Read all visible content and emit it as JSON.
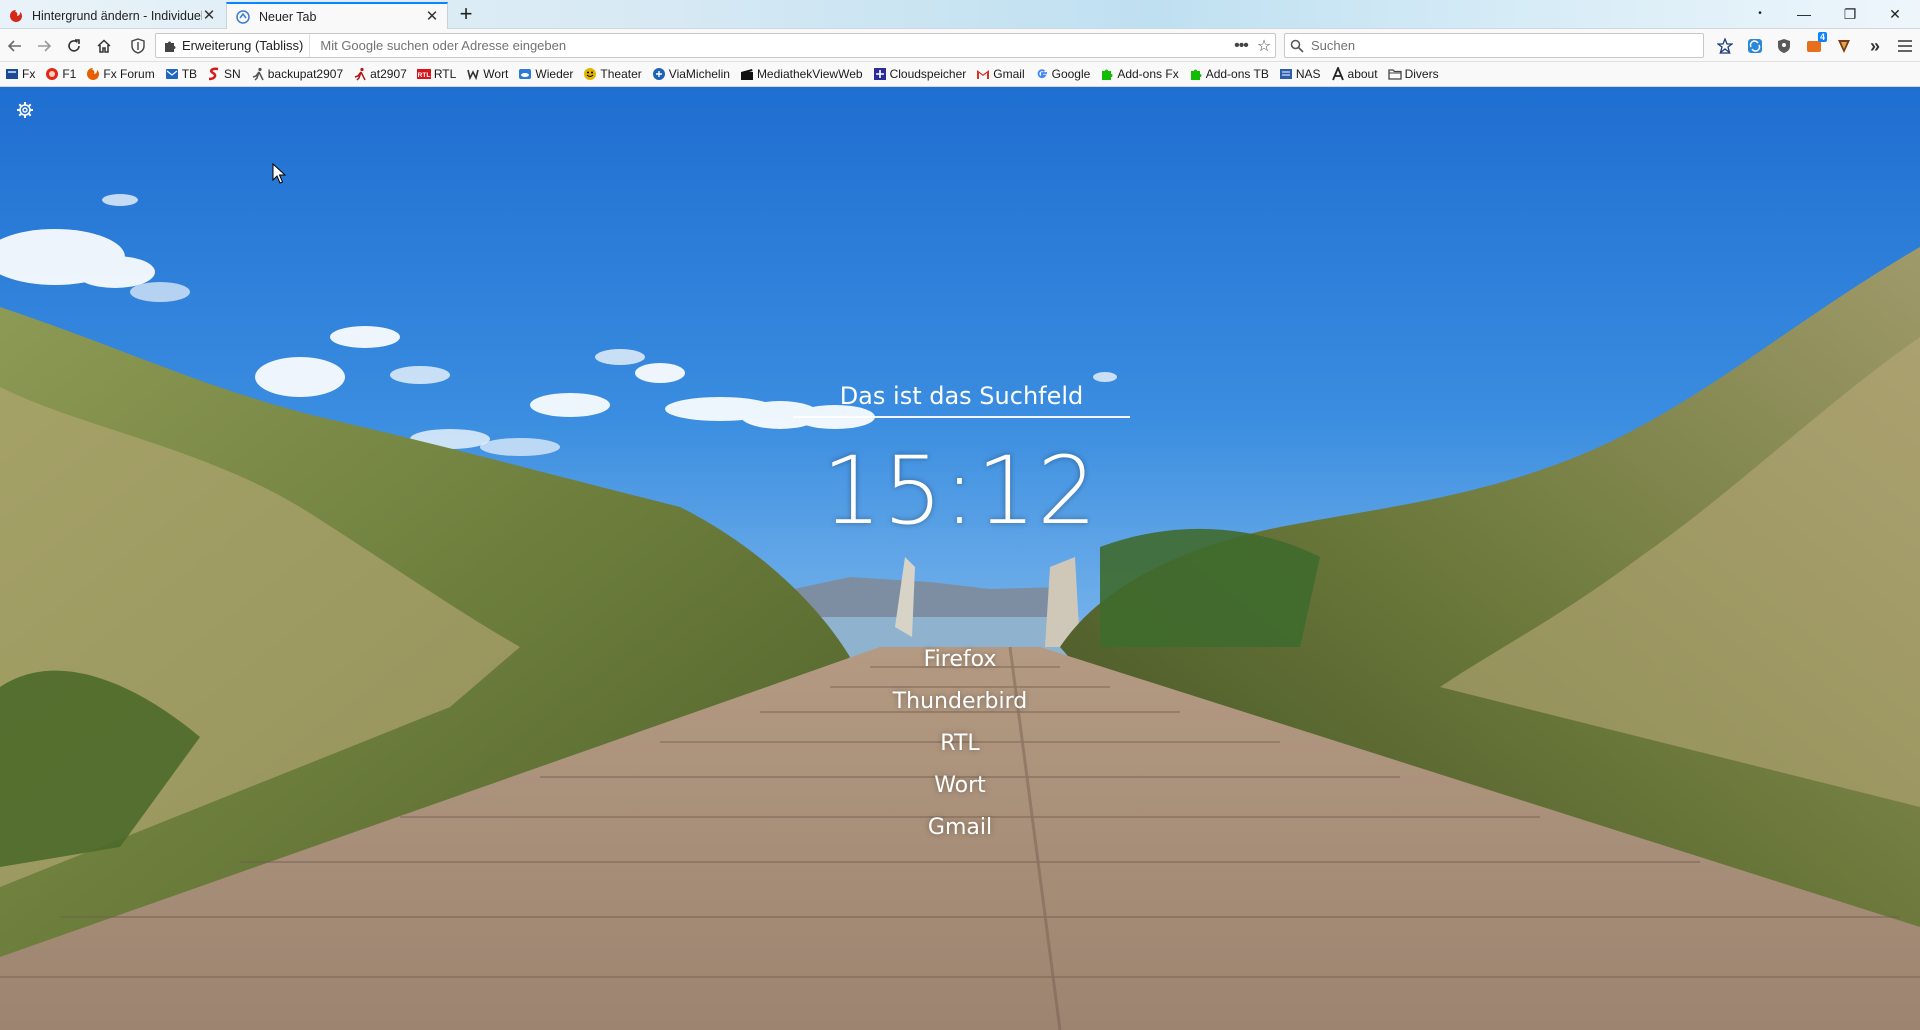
{
  "tabs": [
    {
      "title": "Hintergrund ändern - Individuell",
      "active": false
    },
    {
      "title": "Neuer Tab",
      "active": true
    }
  ],
  "window": {
    "minimize": "—",
    "restore": "❐",
    "close": "✕"
  },
  "navbar": {
    "extension_label": "Erweiterung (Tabliss)",
    "url_placeholder": "Mit Google suchen oder Adresse eingeben",
    "search_placeholder": "Suchen",
    "badge_count": "4"
  },
  "bookmarks": [
    {
      "label": "Fx",
      "icon": "fx-icon",
      "color": "#1a4b9b"
    },
    {
      "label": "F1",
      "icon": "f1-icon",
      "color": "#e0281b"
    },
    {
      "label": "Fx Forum",
      "icon": "firefox-icon",
      "color": "#e66000"
    },
    {
      "label": "TB",
      "icon": "thunderbird-icon",
      "color": "#1f66c2"
    },
    {
      "label": "SN",
      "icon": "sn-icon",
      "color": "#d61a1a"
    },
    {
      "label": "backupat2907",
      "icon": "runner-icon",
      "color": "#555555"
    },
    {
      "label": "at2907",
      "icon": "runner-icon",
      "color": "#b01818"
    },
    {
      "label": "RTL",
      "icon": "rtl-icon",
      "color": "#d8151b"
    },
    {
      "label": "Wort",
      "icon": "wort-icon",
      "color": "#333333"
    },
    {
      "label": "Wieder",
      "icon": "cloud-icon",
      "color": "#2c7ad6"
    },
    {
      "label": "Theater",
      "icon": "smiley-icon",
      "color": "#e4b500"
    },
    {
      "label": "ViaMichelin",
      "icon": "michelin-icon",
      "color": "#1d63b5"
    },
    {
      "label": "MediathekViewWeb",
      "icon": "clapper-icon",
      "color": "#111111"
    },
    {
      "label": "Cloudspeicher",
      "icon": "plus-icon",
      "color": "#2b2b9a"
    },
    {
      "label": "Gmail",
      "icon": "gmail-icon",
      "color": "#d93025"
    },
    {
      "label": "Google",
      "icon": "google-icon",
      "color": "#4285f4"
    },
    {
      "label": "Add-ons Fx",
      "icon": "puzzle-icon",
      "color": "#12bc00"
    },
    {
      "label": "Add-ons TB",
      "icon": "puzzle-icon",
      "color": "#12bc00"
    },
    {
      "label": "NAS",
      "icon": "nas-icon",
      "color": "#2b5fae"
    },
    {
      "label": "about",
      "icon": "a-icon",
      "color": "#222222"
    },
    {
      "label": "Divers",
      "icon": "folder-icon",
      "color": "#444444"
    }
  ],
  "newtab": {
    "search_placeholder": "Das ist das Suchfeld",
    "clock": "15:12",
    "links": [
      "Firefox",
      "Thunderbird",
      "RTL",
      "Wort",
      "Gmail"
    ]
  }
}
